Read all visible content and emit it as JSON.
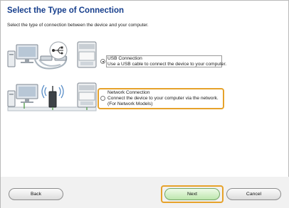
{
  "header": {
    "title": "Select the Type of Connection"
  },
  "instruction": "Select the type of connection between the device and your computer.",
  "options": [
    {
      "title": "USB Connection",
      "description": "Use a USB cable to connect the device to your computer.",
      "selected": true
    },
    {
      "title": "Network Connection",
      "description": "Connect the device to your computer via the network.",
      "note": "(For Network Models)",
      "selected": false
    }
  ],
  "buttons": {
    "back": "Back",
    "next": "Next",
    "cancel": "Cancel"
  },
  "colors": {
    "title": "#163e8c",
    "focus": "#e6a22a",
    "next_button": "#bde6ad"
  },
  "icons": [
    "computer-icon",
    "usb-icon",
    "printer-icon",
    "wireless-router-icon"
  ]
}
